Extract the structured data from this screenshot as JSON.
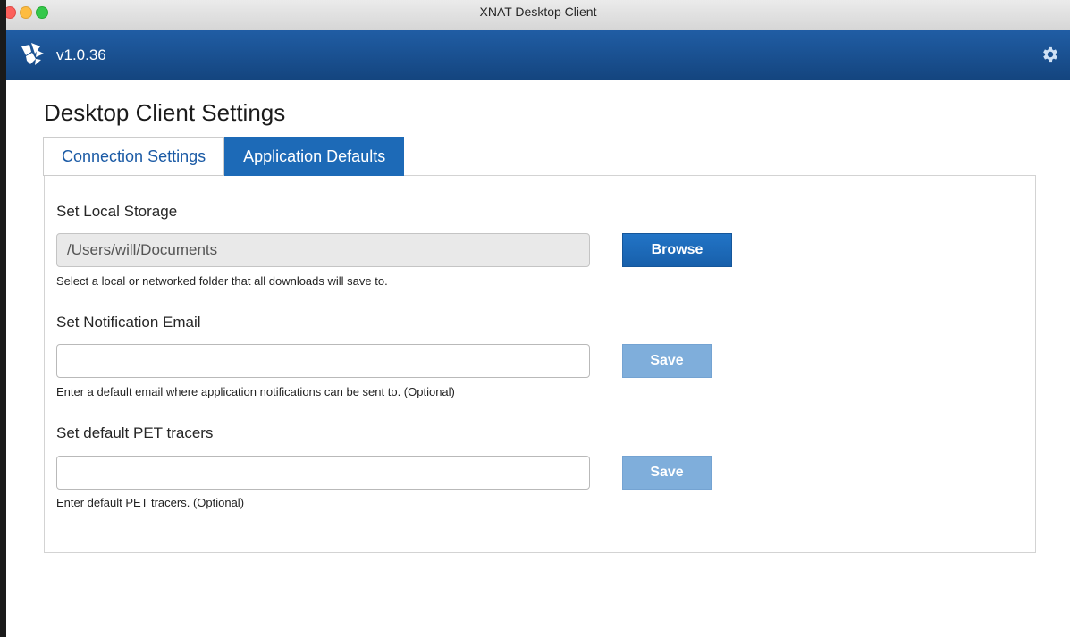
{
  "window": {
    "title": "XNAT Desktop Client"
  },
  "appbar": {
    "version": "v1.0.36",
    "logo_icon": "xnat-logo-icon",
    "settings_icon": "gear-icon"
  },
  "page": {
    "title": "Desktop Client Settings"
  },
  "tabs": [
    {
      "label": "Connection Settings",
      "active": false
    },
    {
      "label": "Application Defaults",
      "active": true
    }
  ],
  "sections": {
    "storage": {
      "label": "Set Local Storage",
      "value": "/Users/will/Documents",
      "help": "Select a local or networked folder that all downloads will save to.",
      "button": "Browse"
    },
    "email": {
      "label": "Set Notification Email",
      "value": "",
      "help": "Enter a default email where application notifications can be sent to. (Optional)",
      "button": "Save"
    },
    "pet": {
      "label": "Set default PET tracers",
      "value": "",
      "help": "Enter default PET tracers. (Optional)",
      "button": "Save"
    }
  },
  "colors": {
    "appbar": "#1a5294",
    "primary_button": "#1d6ab7",
    "disabled_button": "#7faedb",
    "tab_active": "#1d6ab7"
  }
}
